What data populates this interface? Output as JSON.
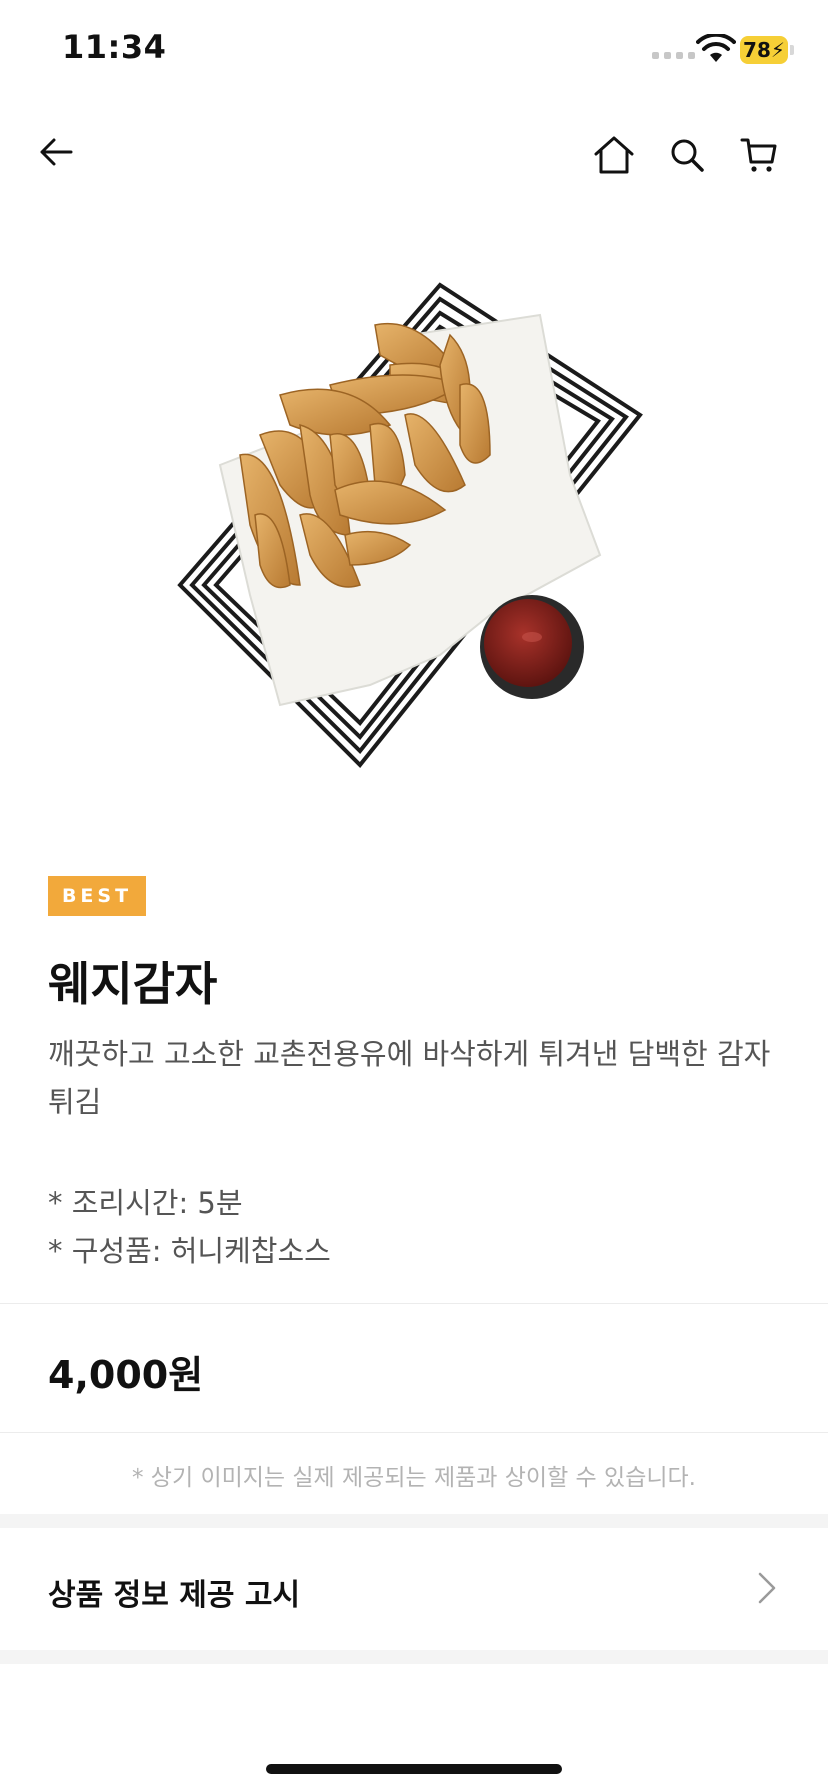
{
  "status_bar": {
    "time": "11:34",
    "battery": "78"
  },
  "nav": {
    "back_icon": "arrow-left-icon",
    "home_icon": "home-icon",
    "search_icon": "search-icon",
    "cart_icon": "cart-icon"
  },
  "product": {
    "badge": "BEST",
    "name": "웨지감자",
    "description": "깨끗하고 고소한 교촌전용유에 바삭하게 튀겨낸 담백한 감자튀김",
    "specs": [
      "* 조리시간: 5분",
      "* 구성품: 허니케찹소스"
    ],
    "price": "4,000원",
    "disclaimer": "* 상기 이미지는 실제 제공되는 제품과 상이할 수 있습니다."
  },
  "notice": {
    "label": "상품 정보 제공 고시",
    "icon": "chevron-right-icon"
  },
  "colors": {
    "badge": "#f2a93b",
    "battery": "#f6cf36",
    "text_primary": "#111111",
    "text_secondary": "#555555"
  }
}
